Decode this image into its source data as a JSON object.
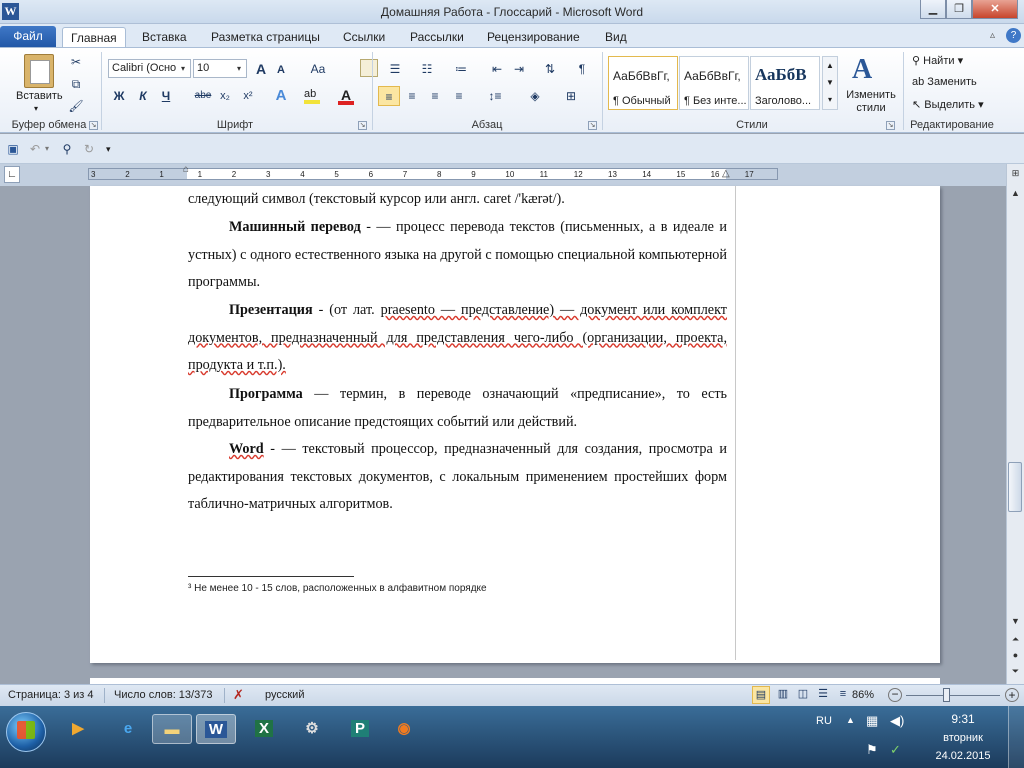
{
  "window": {
    "title": "Домашняя Работа - Глоссарий  -  Microsoft Word",
    "app_icon": "word-logo",
    "controls": [
      "minimize",
      "restore",
      "close"
    ]
  },
  "ribbon_tabs": {
    "file": "Файл",
    "items": [
      "Главная",
      "Вставка",
      "Разметка страницы",
      "Ссылки",
      "Рассылки",
      "Рецензирование",
      "Вид"
    ]
  },
  "ribbon": {
    "clipboard": {
      "paste_label": "Вставить",
      "group_label": "Буфер обмена"
    },
    "font": {
      "font_name": "Calibri (Осно",
      "font_size": "10",
      "grow": "A",
      "shrink": "A",
      "case": "Aa",
      "bold": "Ж",
      "italic": "К",
      "underline": "Ч",
      "strike": "abe",
      "sub": "x₂",
      "sup": "x²",
      "group_label": "Шрифт"
    },
    "paragraph": {
      "group_label": "Абзац"
    },
    "styles": {
      "items": [
        {
          "preview": "АаБбВвГг,",
          "name": "¶ Обычный"
        },
        {
          "preview": "АаБбВвГг,",
          "name": "¶ Без инте..."
        },
        {
          "preview": "АаБбВ",
          "name": "Заголово..."
        }
      ],
      "change_label": "Изменить стили",
      "group_label": "Стили"
    },
    "editing": {
      "find": "Найти",
      "replace": "Заменить",
      "select": "Выделить",
      "group_label": "Редактирование"
    }
  },
  "ruler": {
    "numbers": [
      "3",
      "2",
      "1",
      "1",
      "2",
      "3",
      "4",
      "5",
      "6",
      "7",
      "8",
      "9",
      "10",
      "11",
      "12",
      "13",
      "14",
      "15",
      "16",
      "17"
    ]
  },
  "document": {
    "line0": "следующий символ (текстовый курсор или англ. caret /'kærət/).",
    "p1": {
      "term": "Машинный перевод",
      "text": " - — процесс перевода текстов (письменных, а в идеале и устных) с одного естественного языка на другой с помощью специальной компьютерной программы."
    },
    "p2": {
      "term": "Презентация",
      "pre": "  - (от лат. ",
      "underlined": "praesento — представление) — документ или комплект документов, предназначенный для представления чего-либо (организации, проекта, продукта и т.п.)."
    },
    "p3": {
      "term": "Программа",
      "text": " — термин, в переводе означающий «предписание», то есть предварительное описание предстоящих событий или действий."
    },
    "p4": {
      "term": "Word",
      "text": "  - — текстовый процессор, предназначенный для создания, просмотра и редактирования текстовых документов, с локальным применением простейших форм таблично-матричных алгоритмов."
    },
    "footnote": "³  Не менее 10  - 15 слов, расположенных в алфавитном порядке"
  },
  "statusbar": {
    "page": "Страница: 3 из 4",
    "words": "Число слов: 13/373",
    "language": "русский",
    "zoom": "86%",
    "zoom_level": 86
  },
  "taskbar": {
    "lang": "RU",
    "time": "9:31",
    "day": "вторник",
    "date": "24.02.2015",
    "apps": [
      "media-player-icon",
      "internet-explorer-icon",
      "explorer-icon",
      "word-icon",
      "excel-icon",
      "app-icon",
      "publisher-icon",
      "firefox-icon"
    ]
  },
  "colors": {
    "file_tab": "#2b5797",
    "title_bar": "#dde8f4",
    "taskbar": "#1c3b5c"
  }
}
